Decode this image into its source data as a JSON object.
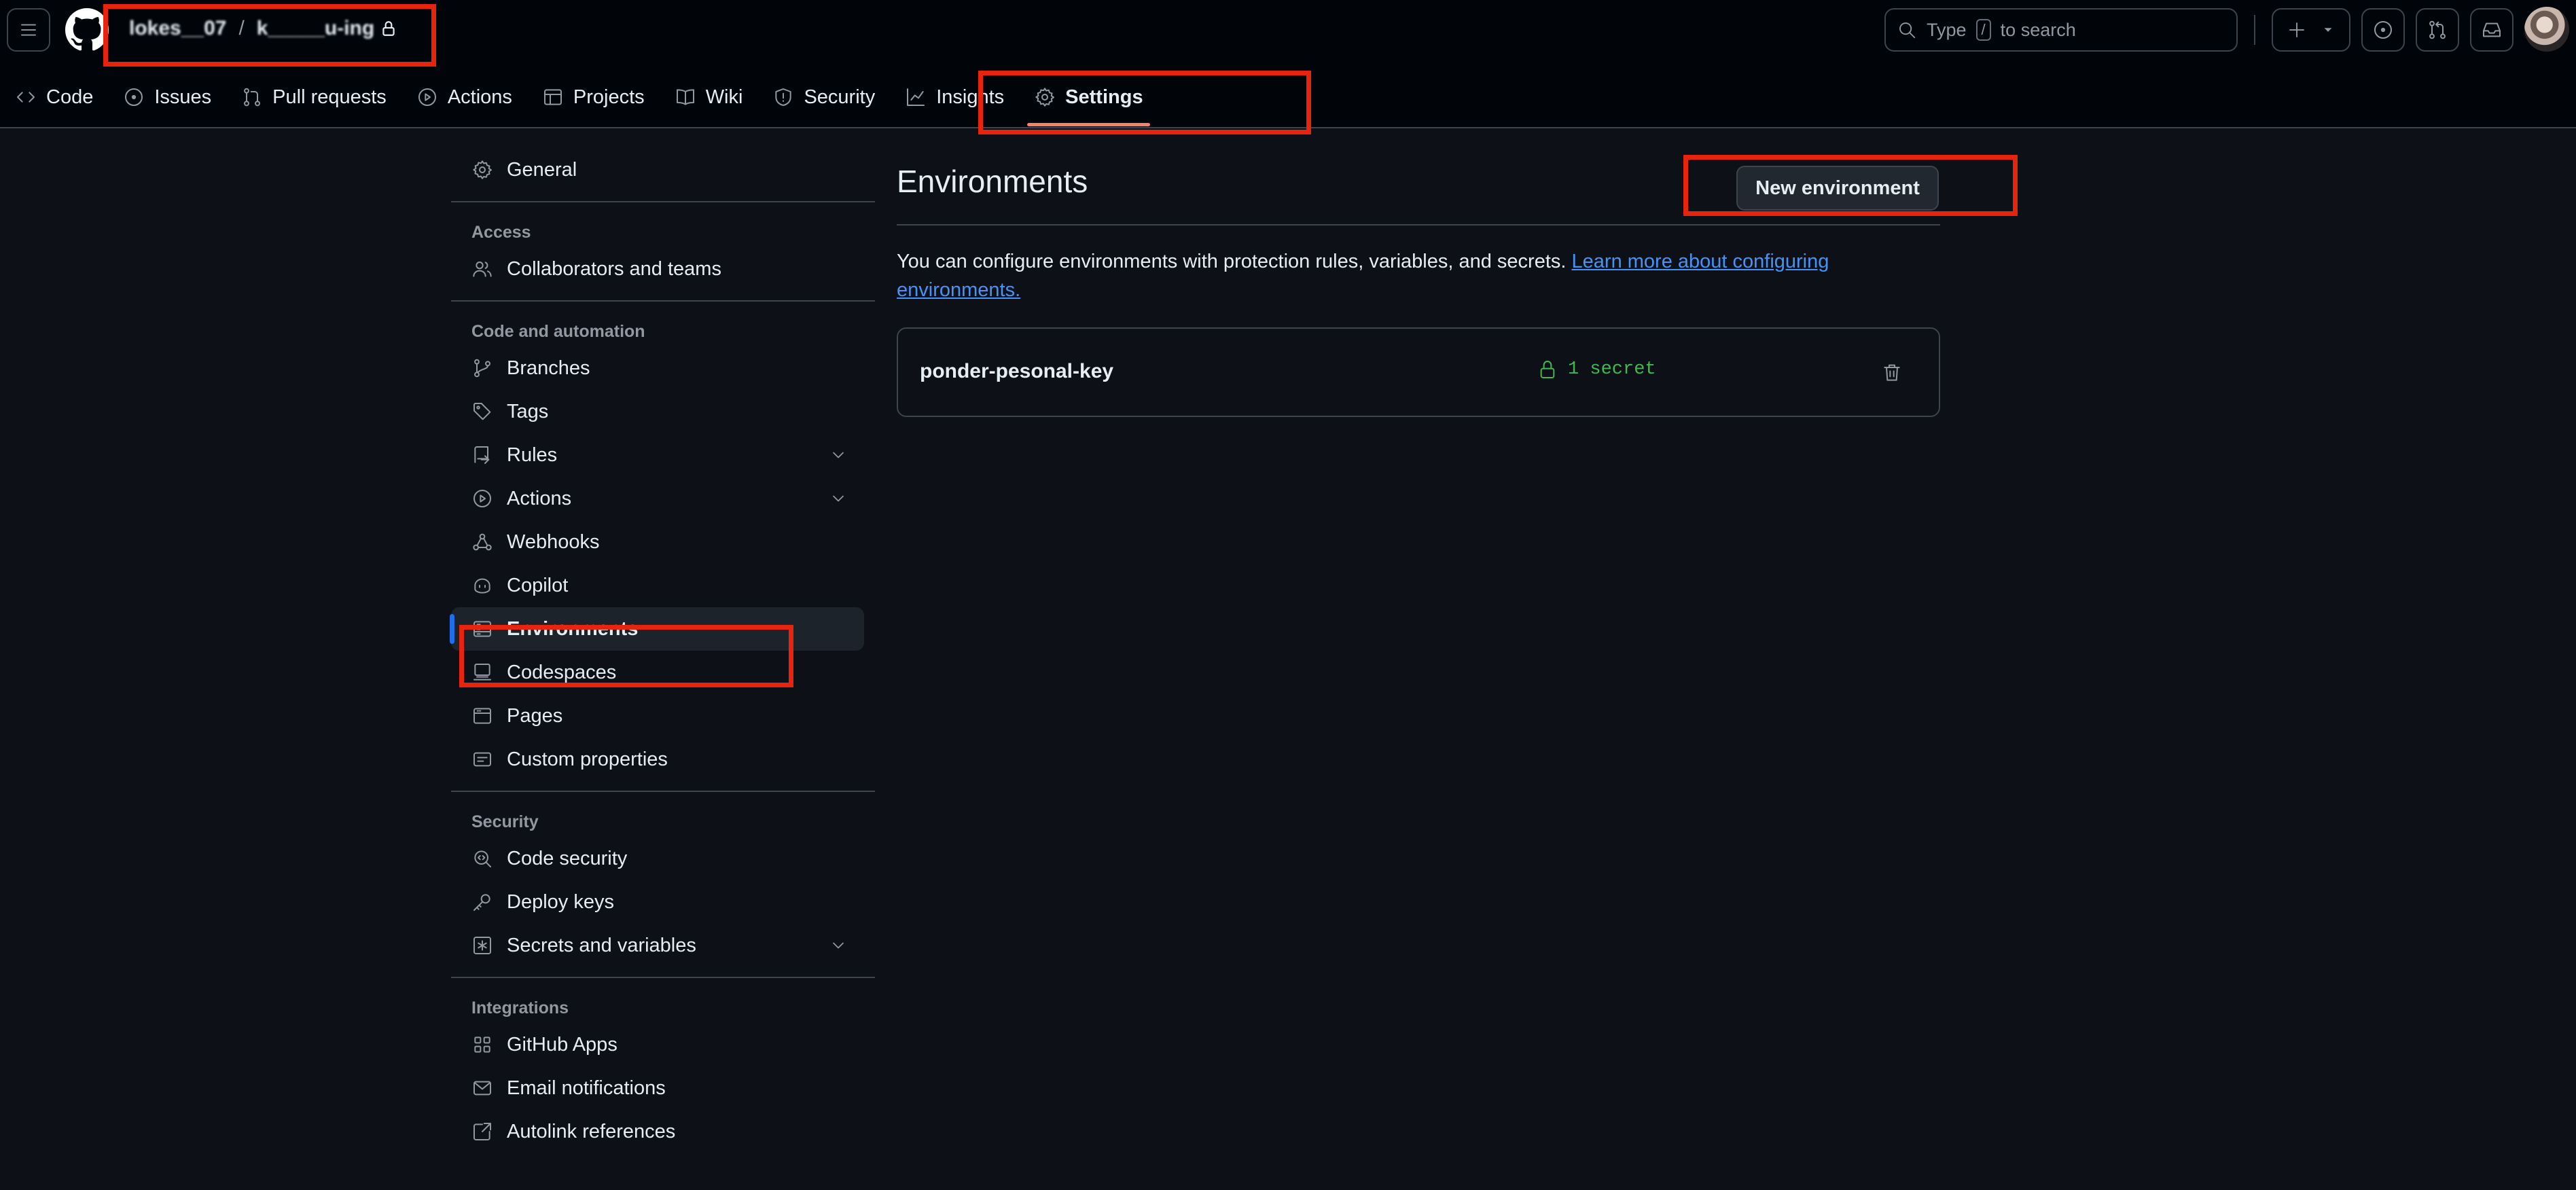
{
  "header": {
    "owner": "lokes__07",
    "separator": "/",
    "repo": "k_____u-ing",
    "search": {
      "prefix": "Type",
      "key": "/",
      "suffix": "to search"
    },
    "icons": [
      "hamburger-icon",
      "github-logo-icon",
      "lock-icon",
      "search-icon",
      "plus-icon",
      "triangle-down-icon",
      "issue-opened-icon",
      "git-pull-request-icon",
      "inbox-icon"
    ]
  },
  "tabs": [
    {
      "label": "Code",
      "icon": "code-icon"
    },
    {
      "label": "Issues",
      "icon": "issue-opened-icon"
    },
    {
      "label": "Pull requests",
      "icon": "git-pull-request-icon"
    },
    {
      "label": "Actions",
      "icon": "play-icon"
    },
    {
      "label": "Projects",
      "icon": "table-icon"
    },
    {
      "label": "Wiki",
      "icon": "book-icon"
    },
    {
      "label": "Security",
      "icon": "shield-icon"
    },
    {
      "label": "Insights",
      "icon": "graph-icon"
    },
    {
      "label": "Settings",
      "icon": "gear-icon",
      "selected": true
    }
  ],
  "sidebar": {
    "general": "General",
    "access": {
      "heading": "Access",
      "items": [
        "Collaborators and teams"
      ]
    },
    "code_automation": {
      "heading": "Code and automation",
      "items": [
        "Branches",
        "Tags",
        "Rules",
        "Actions",
        "Webhooks",
        "Copilot",
        "Environments",
        "Codespaces",
        "Pages",
        "Custom properties"
      ]
    },
    "security": {
      "heading": "Security",
      "items": [
        "Code security",
        "Deploy keys",
        "Secrets and variables"
      ]
    },
    "integrations": {
      "heading": "Integrations",
      "items": [
        "GitHub Apps",
        "Email notifications",
        "Autolink references"
      ]
    },
    "selected": "Environments"
  },
  "main": {
    "title": "Environments",
    "new_button": "New environment",
    "intro_text": "You can configure environments with protection rules, variables, and secrets. ",
    "intro_link": "Learn more about configuring environments.",
    "environments": [
      {
        "name": "ponder-pesonal-key",
        "secrets": "1 secret"
      }
    ]
  },
  "colors": {
    "background": "#0d1117",
    "header": "#010409",
    "accent": "#1f6feb",
    "selected_underline": "#f78166",
    "link": "#4493f8",
    "success": "#3fb950",
    "highlight": "#e8240e"
  }
}
